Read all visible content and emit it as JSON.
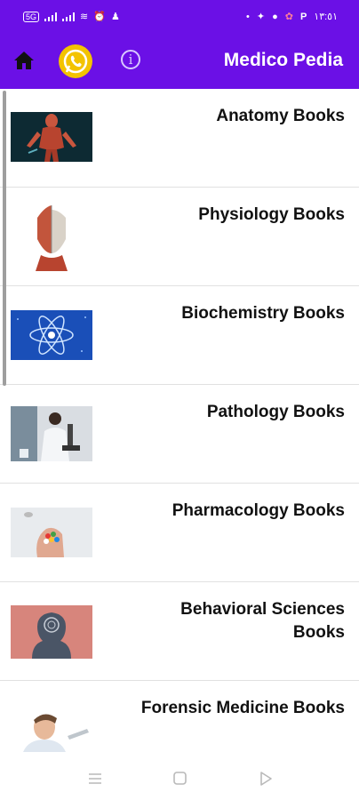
{
  "status_bar": {
    "time": "١٣:٥١",
    "sim_label": "5G",
    "letter": "P"
  },
  "app_bar": {
    "title": "Medico Pedia",
    "info_glyph": "i"
  },
  "books": [
    {
      "label": "Anatomy Books",
      "icon": "anatomy-thumbnail"
    },
    {
      "label": "Physiology Books",
      "icon": "physiology-thumbnail"
    },
    {
      "label": "Biochemistry Books",
      "icon": "biochemistry-thumbnail"
    },
    {
      "label": "Pathology Books",
      "icon": "pathology-thumbnail"
    },
    {
      "label": "Pharmacology  Books",
      "icon": "pharmacology-thumbnail"
    },
    {
      "label": "Behavioral Sciences Books",
      "icon": "behavioral-sciences-thumbnail"
    },
    {
      "label": "Forensic Medicine Books",
      "icon": "forensic-medicine-thumbnail"
    }
  ],
  "nav_bar": {
    "buttons": [
      "menu-icon",
      "home-square-icon",
      "back-triangle-icon"
    ]
  },
  "colors": {
    "accent": "#6b10e6",
    "whatsapp": "#f3c300",
    "divider": "#e1e1e1"
  }
}
